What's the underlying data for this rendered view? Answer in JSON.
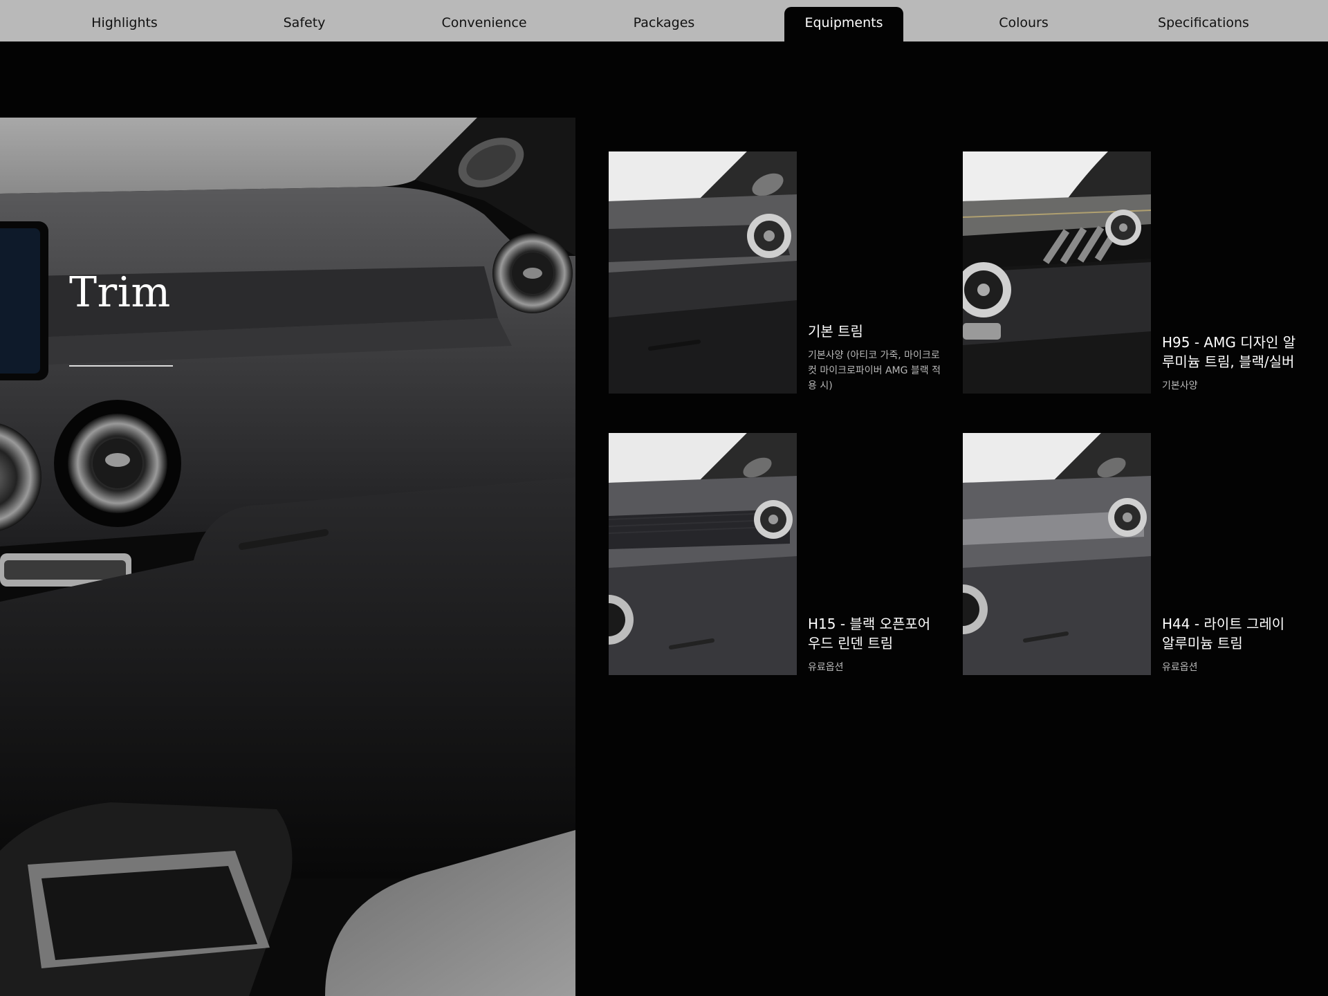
{
  "nav": {
    "tabs": [
      {
        "label": "Highlights",
        "active": false
      },
      {
        "label": "Safety",
        "active": false
      },
      {
        "label": "Convenience",
        "active": false
      },
      {
        "label": "Packages",
        "active": false
      },
      {
        "label": "Equipments",
        "active": true
      },
      {
        "label": "Colours",
        "active": false
      },
      {
        "label": "Specifications",
        "active": false
      }
    ]
  },
  "hero": {
    "title": "Trim",
    "image_icon": "car-interior-dashboard-image"
  },
  "trims": [
    {
      "name": "기본 트림",
      "description": "기본사양 (아티코 가죽, 마이크로컷 마이크로파이버 AMG 블랙 적용 시)",
      "variant": "standard"
    },
    {
      "name": "H95 - AMG 디자인 알루미늄 트림, 블랙/실버",
      "description": "기본사양",
      "variant": "amg"
    },
    {
      "name": "H15 - 블랙 오픈포어 우드 린덴 트림",
      "description": "유료옵션",
      "variant": "wood"
    },
    {
      "name": "H44 - 라이트 그레이 알루미늄 트림",
      "description": "유료옵션",
      "variant": "grey"
    }
  ],
  "colors": {
    "nav_bg": "#b9b9b9",
    "page_bg": "#030303",
    "text_primary": "#ffffff",
    "text_secondary": "#b8b8b8"
  }
}
